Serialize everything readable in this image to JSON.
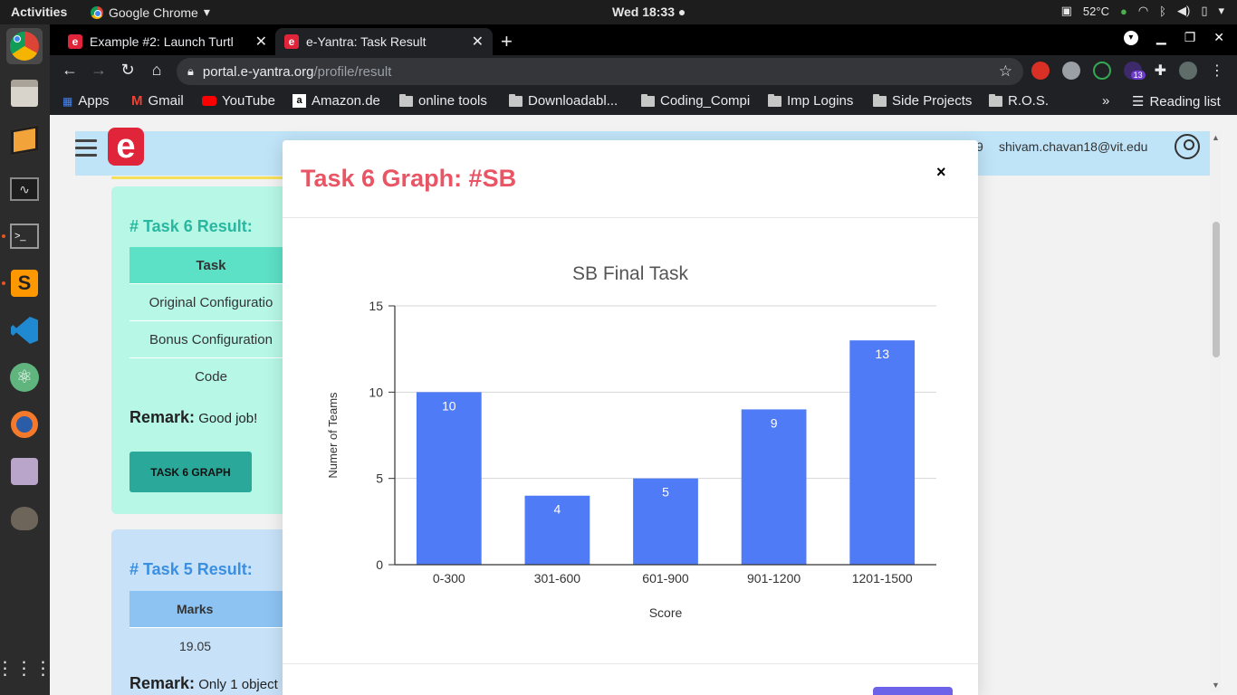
{
  "system_bar": {
    "activities": "Activities",
    "app_name": "Google Chrome",
    "clock": "Wed 18:33",
    "temperature": "52°C"
  },
  "browser": {
    "tabs": [
      {
        "title": "Example #2: Launch Turtl",
        "active": false
      },
      {
        "title": "e-Yantra: Task Result",
        "active": true
      }
    ],
    "url_host": "portal.e-yantra.org",
    "url_path": "/profile/result",
    "extension_badge": "13",
    "bookmarks": [
      {
        "label": "Apps",
        "icon": "apps-grid-icon"
      },
      {
        "label": "Gmail",
        "icon": "gmail-icon"
      },
      {
        "label": "YouTube",
        "icon": "youtube-icon"
      },
      {
        "label": "Amazon.de",
        "icon": "amazon-icon"
      },
      {
        "label": "online tools",
        "icon": "folder-icon"
      },
      {
        "label": "Downloadabl...",
        "icon": "folder-icon"
      },
      {
        "label": "Coding_Compi",
        "icon": "folder-icon"
      },
      {
        "label": "Imp Logins",
        "icon": "folder-icon"
      },
      {
        "label": "Side Projects",
        "icon": "folder-icon"
      },
      {
        "label": "R.O.S.",
        "icon": "folder-icon"
      }
    ],
    "overflow": "»",
    "reading_list": "Reading list"
  },
  "page": {
    "header_number": "9",
    "user_email": "shivam.chavan18@vit.edu",
    "task6": {
      "heading": "# Task 6 Result:",
      "column_header": "Task",
      "rows": [
        "Original Configuratio",
        "Bonus Configuration",
        "Code"
      ],
      "remark_label": "Remark:",
      "remark_text": "Good job!",
      "graph_button": "TASK 6 GRAPH"
    },
    "task5": {
      "heading": "# Task 5 Result:",
      "column_header": "Marks",
      "marks": "19.05",
      "remark_label": "Remark:",
      "remark_text": "Only 1 object"
    }
  },
  "modal": {
    "title": "Task 6 Graph: #SB",
    "close": "×"
  },
  "colors": {
    "accent_red": "#e95564",
    "bar_blue": "#4f7bf7",
    "teal_card": "#b6f7e6",
    "blue_card": "#c6e1f8"
  },
  "chart_data": {
    "type": "bar",
    "title": "SB Final Task",
    "xlabel": "Score",
    "ylabel": "Numer of Teams",
    "categories": [
      "0-300",
      "301-600",
      "601-900",
      "901-1200",
      "1201-1500"
    ],
    "values": [
      10,
      4,
      5,
      9,
      13
    ],
    "ylim": [
      0,
      15
    ],
    "yticks": [
      0,
      5,
      10,
      15
    ],
    "grid": true,
    "data_labels": true
  }
}
